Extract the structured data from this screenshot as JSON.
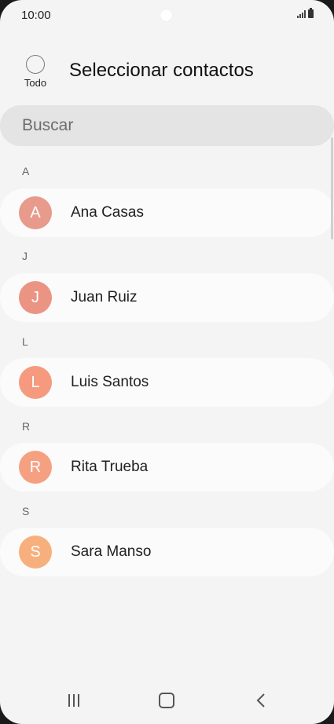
{
  "status_bar": {
    "time": "10:00"
  },
  "header": {
    "select_all_label": "Todo",
    "title": "Seleccionar contactos"
  },
  "search": {
    "placeholder": "Buscar"
  },
  "sections": [
    {
      "letter": "A",
      "contact": {
        "initial": "A",
        "name": "Ana Casas",
        "color": "#e89a8d"
      }
    },
    {
      "letter": "J",
      "contact": {
        "initial": "J",
        "name": "Juan Ruiz",
        "color": "#ec9484"
      }
    },
    {
      "letter": "L",
      "contact": {
        "initial": "L",
        "name": "Luis Santos",
        "color": "#f59a7e"
      }
    },
    {
      "letter": "R",
      "contact": {
        "initial": "R",
        "name": "Rita Trueba",
        "color": "#f6a082"
      }
    },
    {
      "letter": "S",
      "contact": {
        "initial": "S",
        "name": "Sara Manso",
        "color": "#f7b07d"
      }
    }
  ],
  "nav": {
    "icons": [
      "recents-icon",
      "home-icon",
      "back-icon"
    ]
  }
}
